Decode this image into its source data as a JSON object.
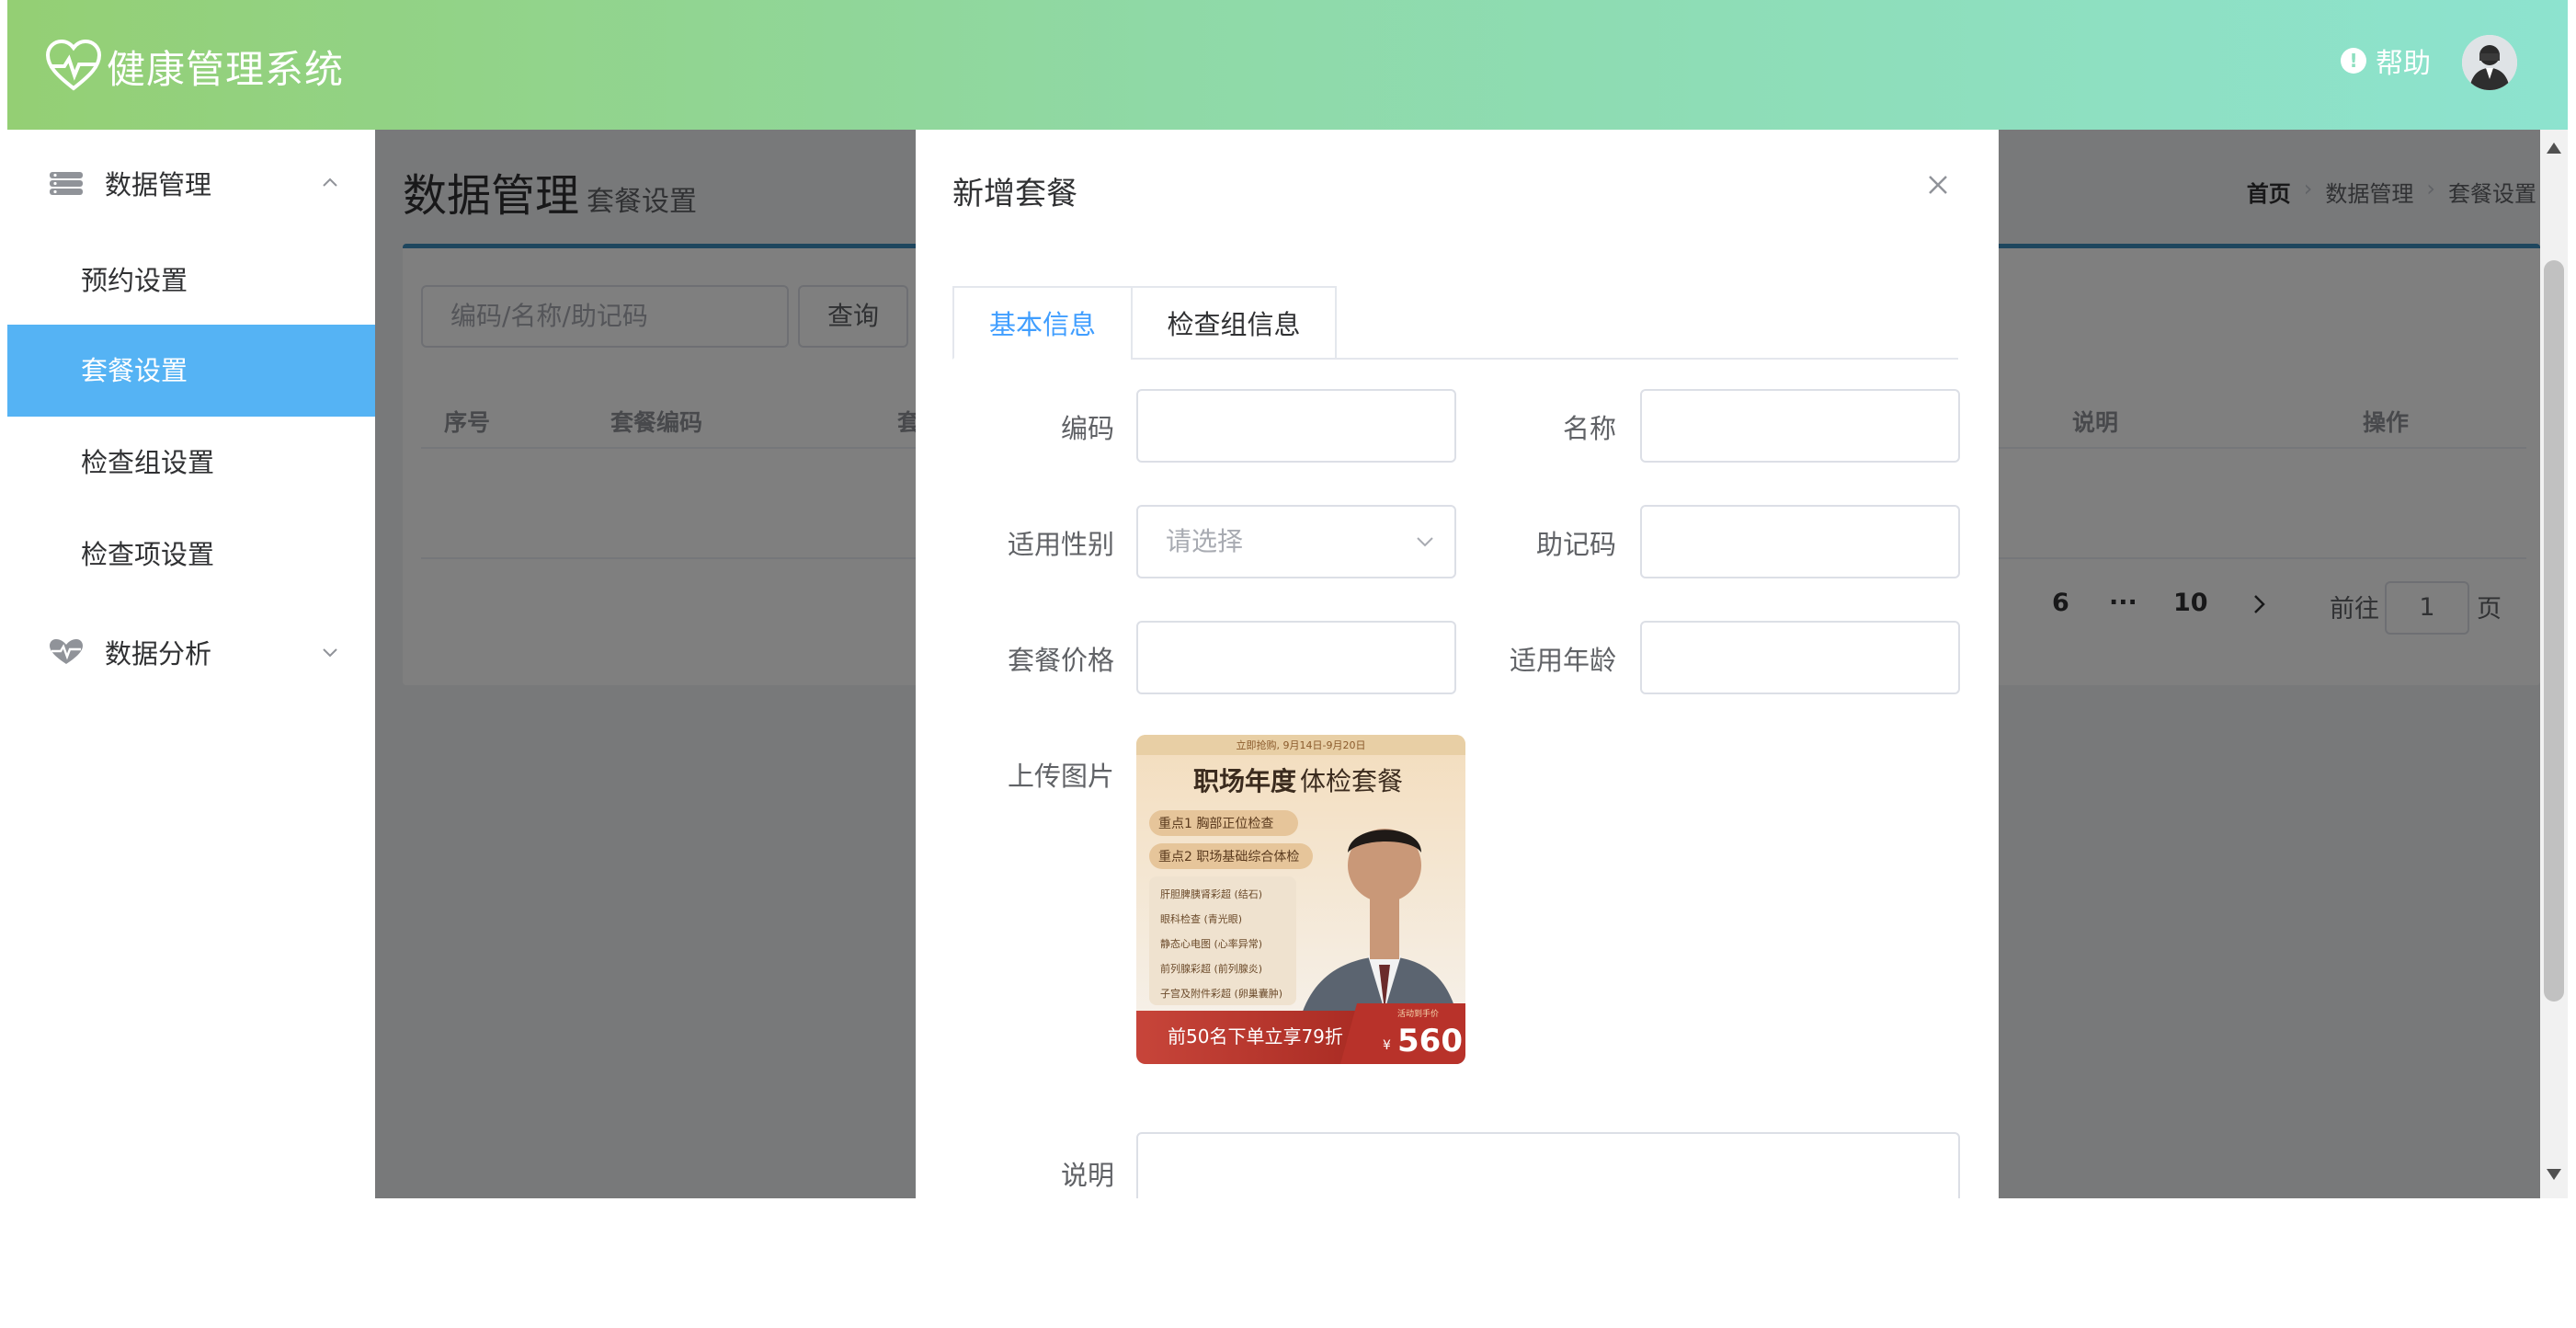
{
  "header": {
    "app_title": "健康管理系统",
    "help_label": "帮助",
    "logo_icon": "heart-pulse-icon",
    "gradient": [
      "#94cf74",
      "#8de3cf"
    ]
  },
  "sidebar": {
    "groups": [
      {
        "label": "数据管理",
        "icon": "database-icon",
        "expanded": true,
        "items": [
          {
            "label": "预约设置"
          },
          {
            "label": "套餐设置",
            "active": true
          },
          {
            "label": "检查组设置"
          },
          {
            "label": "检查项设置"
          }
        ]
      },
      {
        "label": "数据分析",
        "icon": "heart-chart-icon",
        "expanded": false
      }
    ],
    "active_color": "#55b3f4"
  },
  "main": {
    "title": "数据管理",
    "subtitle": "套餐设置",
    "breadcrumb": [
      "首页",
      "数据管理",
      "套餐设置"
    ],
    "search": {
      "placeholder": "编码/名称/助记码",
      "button": "查询"
    },
    "table_headers": [
      "序号",
      "套餐编码",
      "套",
      "说明",
      "操作"
    ],
    "pagination": {
      "pages": [
        "6",
        "···",
        "10"
      ],
      "goto_label": "前往",
      "current": "1",
      "page_suffix": "页"
    }
  },
  "dialog": {
    "title": "新增套餐",
    "tabs": [
      {
        "label": "基本信息",
        "active": true
      },
      {
        "label": "检查组信息"
      }
    ],
    "fields": {
      "code": {
        "label": "编码",
        "value": ""
      },
      "name": {
        "label": "名称",
        "value": ""
      },
      "gender": {
        "label": "适用性别",
        "placeholder": "请选择"
      },
      "mnemonic": {
        "label": "助记码",
        "value": ""
      },
      "price": {
        "label": "套餐价格",
        "value": ""
      },
      "age": {
        "label": "适用年龄",
        "value": ""
      },
      "image": {
        "label": "上传图片"
      },
      "remark": {
        "label": "说明",
        "value": ""
      }
    },
    "poster": {
      "top_text": "立即抢购, 9月14日-9月20日",
      "title_bold": "职场年度",
      "title_rest": "体检套餐",
      "points": [
        "重点1 胸部正位检查",
        "重点2 职场基础综合体检"
      ],
      "checks": [
        "肝胆脾胰肾彩超 (结石)",
        "眼科检查 (青光眼)",
        "静态心电图 (心率异常)",
        "前列腺彩超 (前列腺炎)",
        "子宫及附件彩超 (卵巢囊肿)"
      ],
      "promo": "前50名下单立享79折",
      "price_prefix": "¥",
      "price": "560",
      "price_tag": "活动到手价"
    }
  }
}
